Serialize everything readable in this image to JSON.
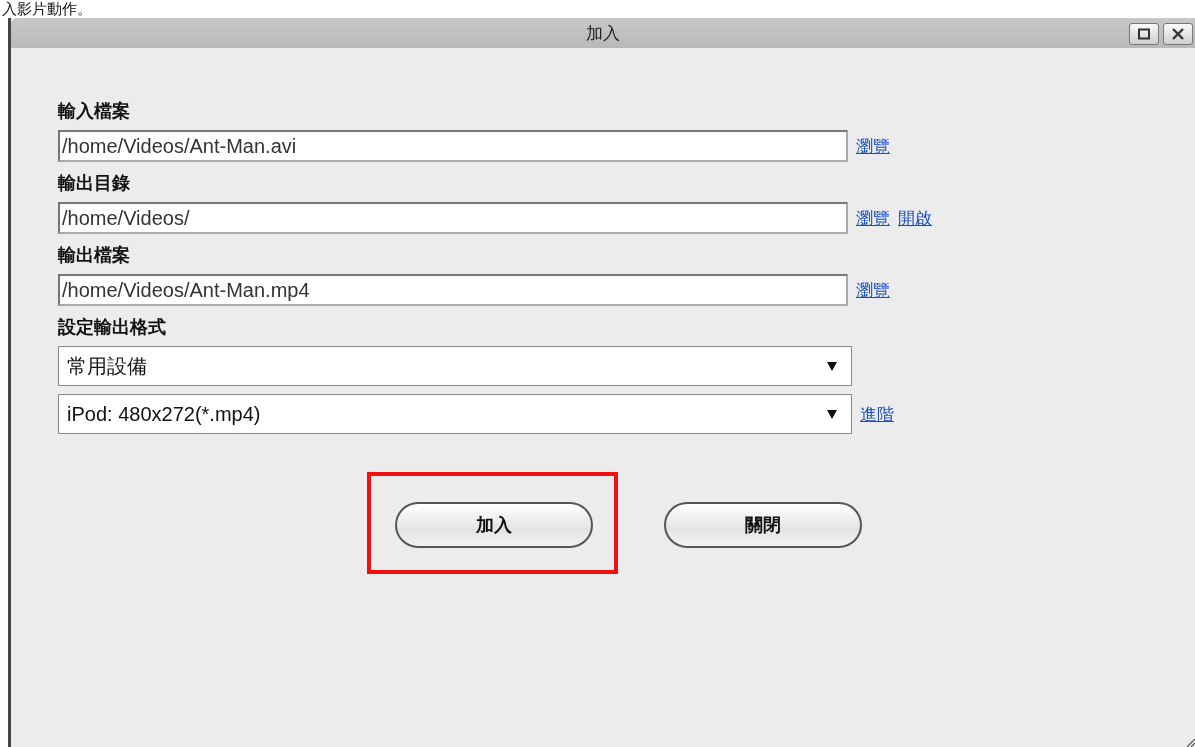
{
  "caption": "入影片動作。",
  "window": {
    "title": "加入"
  },
  "sections": [
    {
      "label": "輸入檔案",
      "fields": [
        {
          "kind": "text",
          "value": "/home/Videos/Ant-Man.avi",
          "links": [
            "瀏覽"
          ]
        }
      ]
    },
    {
      "label": "輸出目錄",
      "fields": [
        {
          "kind": "text",
          "value": "/home/Videos/",
          "links": [
            "瀏覽",
            "開啟"
          ]
        }
      ]
    },
    {
      "label": "輸出檔案",
      "fields": [
        {
          "kind": "text",
          "value": "/home/Videos/Ant-Man.mp4",
          "links": [
            "瀏覽"
          ]
        }
      ]
    },
    {
      "label": "設定輸出格式",
      "fields": [
        {
          "kind": "select",
          "value": "常用設備"
        },
        {
          "kind": "select",
          "value": "iPod: 480x272(*.mp4)",
          "links": [
            "進階"
          ]
        }
      ]
    }
  ],
  "buttons": [
    {
      "label": "加入",
      "highlighted": true
    },
    {
      "label": "關閉",
      "highlighted": false
    }
  ]
}
